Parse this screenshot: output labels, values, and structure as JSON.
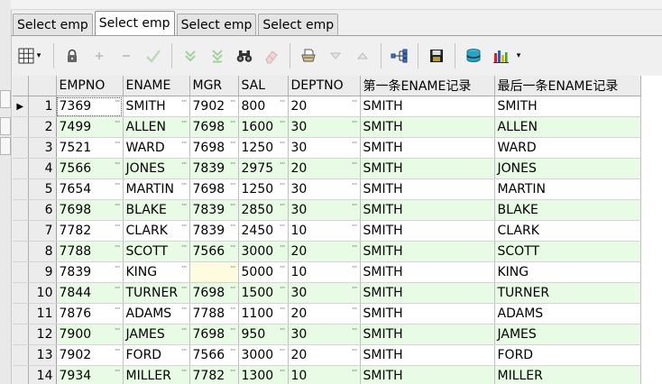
{
  "tabs": [
    {
      "label": "Select emp",
      "active": false
    },
    {
      "label": "Select emp",
      "active": true
    },
    {
      "label": "Select emp",
      "active": false
    },
    {
      "label": "Select emp",
      "active": false
    }
  ],
  "toolbar": {
    "icons": [
      "grid-icon",
      "lock-icon",
      "plus-icon",
      "minus-icon",
      "check-icon",
      "arrow-down-icon",
      "arrow-down-all-icon",
      "binoculars-icon",
      "eraser-icon",
      "print-icon",
      "triangle-down-icon",
      "triangle-up-icon",
      "tree-icon",
      "save-icon",
      "database-icon",
      "chart-icon"
    ],
    "dropdown_glyph": "▾"
  },
  "grid": {
    "columns": [
      "EMPNO",
      "ENAME",
      "MGR",
      "SAL",
      "DEPTNO",
      "第一条ENAME记录",
      "最后一条ENAME记录"
    ],
    "current_row_marker": "▶",
    "cell_dots": "···",
    "rows": [
      {
        "n": "1",
        "cells": [
          "7369",
          "SMITH",
          "7902",
          "800",
          "20",
          "SMITH",
          "SMITH"
        ]
      },
      {
        "n": "2",
        "cells": [
          "7499",
          "ALLEN",
          "7698",
          "1600",
          "30",
          "SMITH",
          "ALLEN"
        ]
      },
      {
        "n": "3",
        "cells": [
          "7521",
          "WARD",
          "7698",
          "1250",
          "30",
          "SMITH",
          "WARD"
        ]
      },
      {
        "n": "4",
        "cells": [
          "7566",
          "JONES",
          "7839",
          "2975",
          "20",
          "SMITH",
          "JONES"
        ]
      },
      {
        "n": "5",
        "cells": [
          "7654",
          "MARTIN",
          "7698",
          "1250",
          "30",
          "SMITH",
          "MARTIN"
        ]
      },
      {
        "n": "6",
        "cells": [
          "7698",
          "BLAKE",
          "7839",
          "2850",
          "30",
          "SMITH",
          "BLAKE"
        ]
      },
      {
        "n": "7",
        "cells": [
          "7782",
          "CLARK",
          "7839",
          "2450",
          "10",
          "SMITH",
          "CLARK"
        ]
      },
      {
        "n": "8",
        "cells": [
          "7788",
          "SCOTT",
          "7566",
          "3000",
          "20",
          "SMITH",
          "SCOTT"
        ]
      },
      {
        "n": "9",
        "cells": [
          "7839",
          "KING",
          "",
          "5000",
          "10",
          "SMITH",
          "KING"
        ]
      },
      {
        "n": "10",
        "cells": [
          "7844",
          "TURNER",
          "7698",
          "1500",
          "30",
          "SMITH",
          "TURNER"
        ]
      },
      {
        "n": "11",
        "cells": [
          "7876",
          "ADAMS",
          "7788",
          "1100",
          "20",
          "SMITH",
          "ADAMS"
        ]
      },
      {
        "n": "12",
        "cells": [
          "7900",
          "JAMES",
          "7698",
          "950",
          "30",
          "SMITH",
          "JAMES"
        ]
      },
      {
        "n": "13",
        "cells": [
          "7902",
          "FORD",
          "7566",
          "3000",
          "20",
          "SMITH",
          "FORD"
        ]
      },
      {
        "n": "14",
        "cells": [
          "7934",
          "MILLER",
          "7782",
          "1300",
          "10",
          "SMITH",
          "MILLER"
        ]
      }
    ]
  }
}
